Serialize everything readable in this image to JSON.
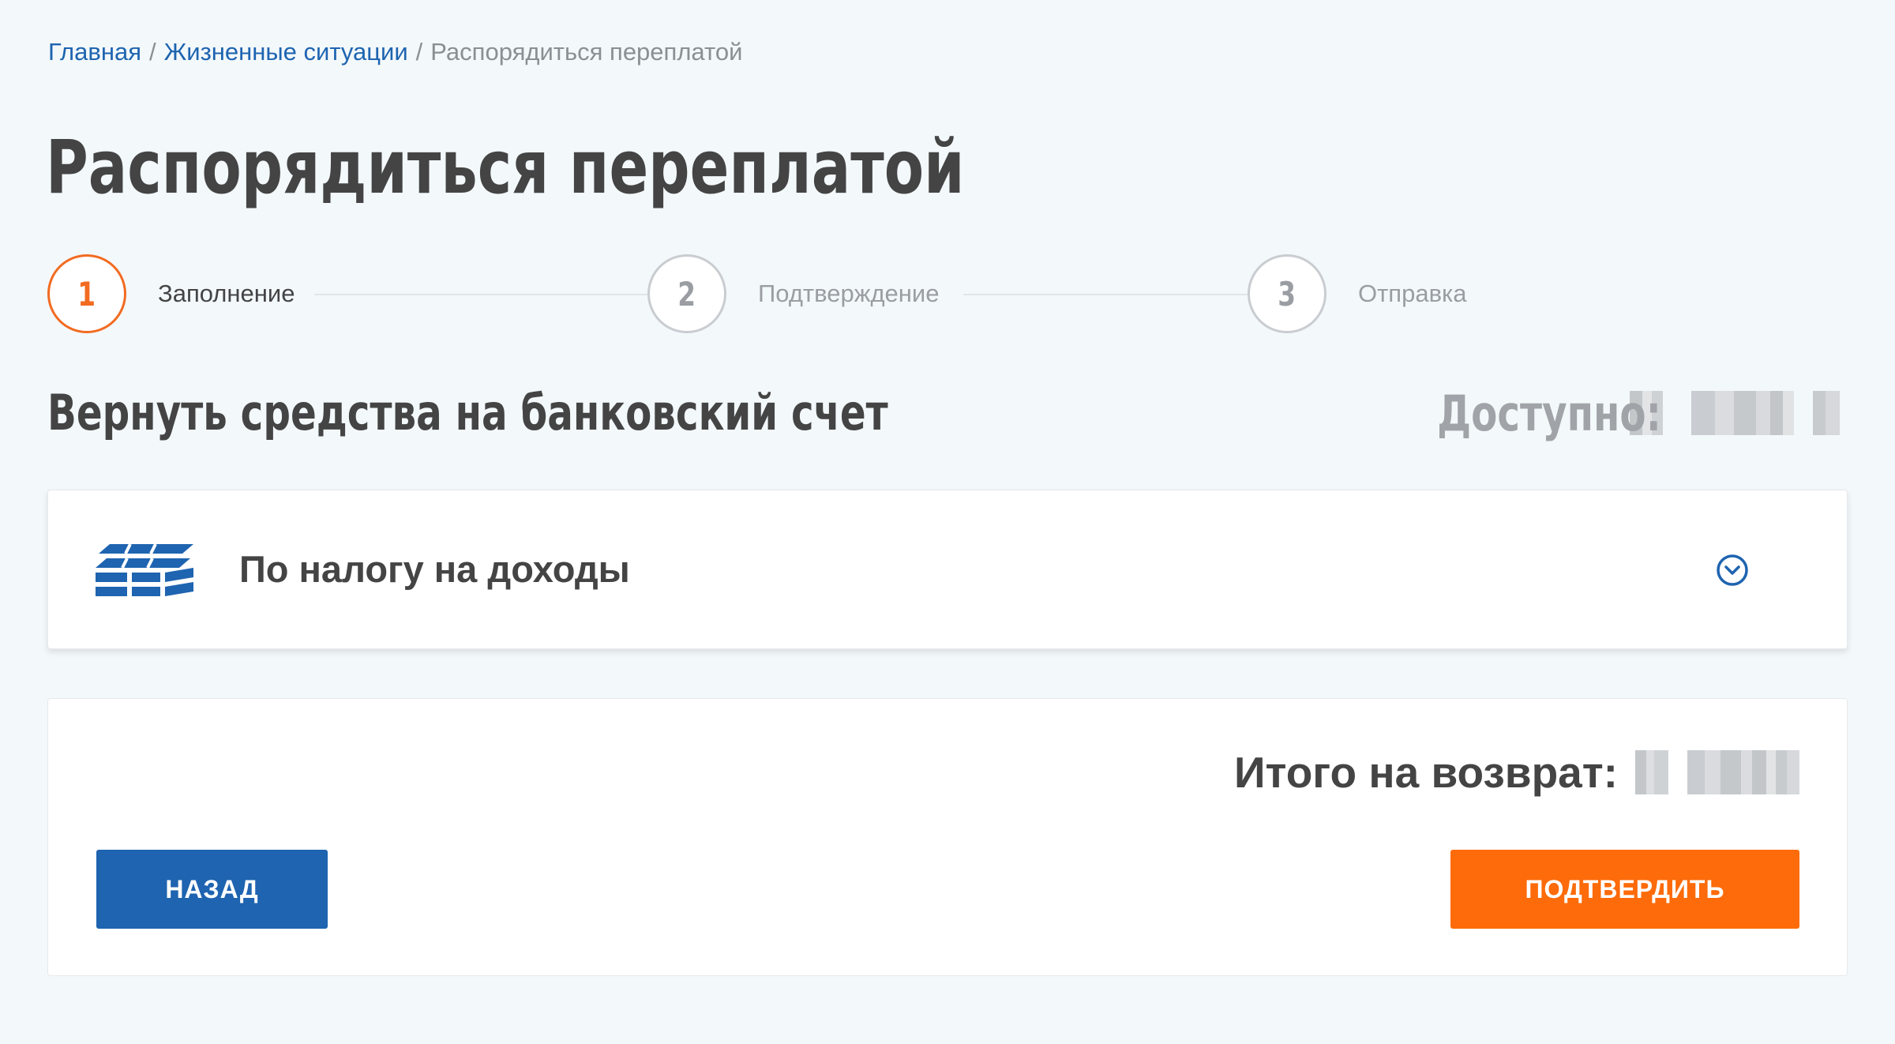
{
  "breadcrumb": {
    "items": [
      {
        "label": "Главная",
        "link": true
      },
      {
        "label": "Жизненные ситуации",
        "link": true
      },
      {
        "label": "Распорядиться переплатой",
        "link": false
      }
    ],
    "separator": "/"
  },
  "page": {
    "title": "Распорядиться переплатой"
  },
  "stepper": {
    "steps": [
      {
        "number": "1",
        "label": "Заполнение",
        "active": true
      },
      {
        "number": "2",
        "label": "Подтверждение",
        "active": false
      },
      {
        "number": "3",
        "label": "Отправка",
        "active": false
      }
    ]
  },
  "section": {
    "heading": "Вернуть средства на банковский счет",
    "available_label": "Доступно:"
  },
  "income_card": {
    "label": "По налогу на доходы",
    "icon": "coins-stack-icon",
    "expand_icon": "chevron-down-circle-icon"
  },
  "total": {
    "label": "Итого на возврат:"
  },
  "buttons": {
    "back": "НАЗАД",
    "confirm": "ПОДТВЕРДИТЬ"
  },
  "colors": {
    "primary_blue": "#1e64b0",
    "accent_orange": "#fd6b0a",
    "step_active": "#f26b21",
    "background": "#f3f8fb"
  }
}
